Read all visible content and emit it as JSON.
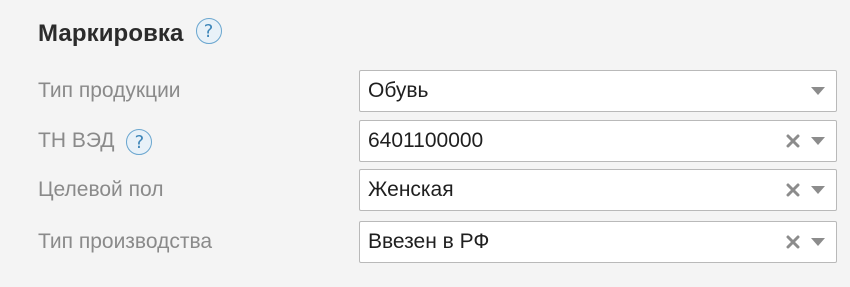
{
  "section": {
    "title": "Маркировка",
    "help_glyph": "?"
  },
  "fields": [
    {
      "label": "Тип продукции",
      "value": "Обувь",
      "has_help": false,
      "clearable": false
    },
    {
      "label": "ТН ВЭД",
      "value": "6401100000",
      "has_help": true,
      "clearable": true
    },
    {
      "label": "Целевой пол",
      "value": "Женская",
      "has_help": false,
      "clearable": true
    },
    {
      "label": "Тип производства",
      "value": "Ввезен в РФ",
      "has_help": false,
      "clearable": true
    }
  ],
  "icons": {
    "help": "question-circle-icon",
    "clear": "x-icon",
    "dropdown": "chevron-down-icon"
  },
  "colors": {
    "background": "#f4f4f4",
    "help_border": "#6aa6cf",
    "help_fill": "#e8f1f8",
    "help_text": "#3d85b8",
    "label_text": "#8a8a8a",
    "value_text": "#1f1f1f",
    "icon_gray": "#8c8c8c"
  }
}
